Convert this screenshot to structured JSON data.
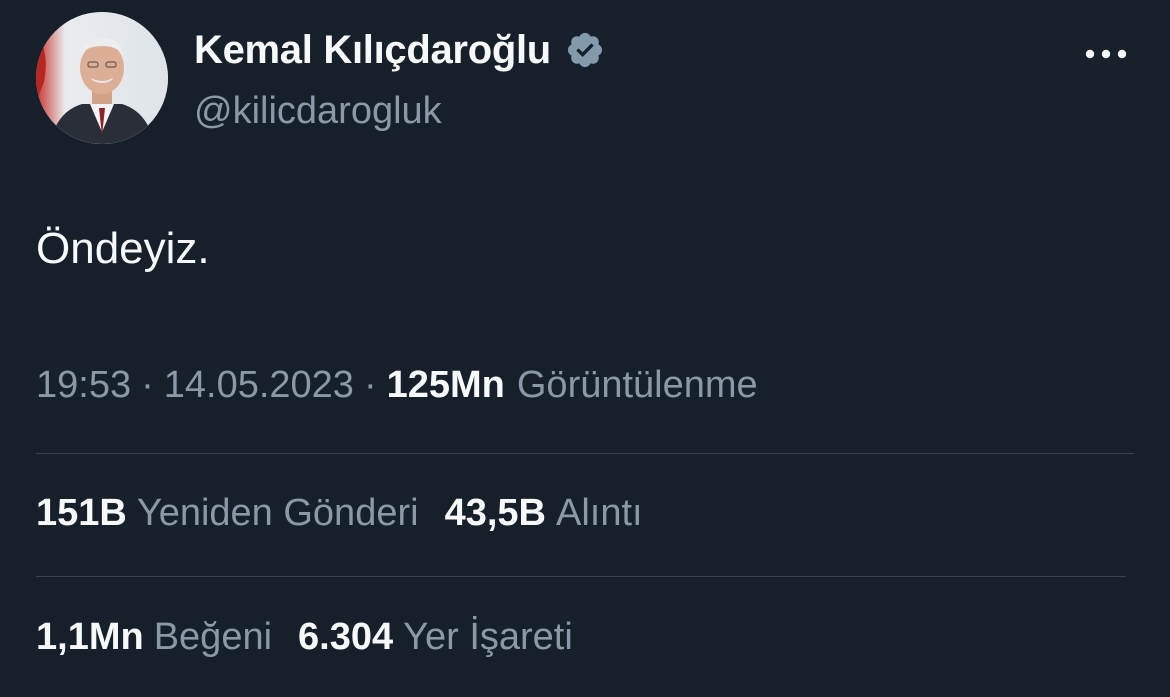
{
  "author": {
    "display_name": "Kemal Kılıçdaroğlu",
    "handle": "@kilicdarogluk",
    "verified_badge_icon": "verified-badge-icon"
  },
  "menu": {
    "more_icon": "more-options-icon"
  },
  "tweet": {
    "text": "Öndeyiz."
  },
  "meta": {
    "time": "19:53",
    "separator": "·",
    "date": "14.05.2023",
    "views_count": "125Mn",
    "views_label": "Görüntülenme"
  },
  "engagement": {
    "retweets_count": "151B",
    "retweets_label": "Yeniden Gönderi",
    "quotes_count": "43,5B",
    "quotes_label": "Alıntı",
    "likes_count": "1,1Mn",
    "likes_label": "Beğeni",
    "bookmarks_count": "6.304",
    "bookmarks_label": "Yer İşareti"
  },
  "colors": {
    "background": "#15202b",
    "primary_text": "#f7f9f9",
    "secondary_text": "#8b98a5",
    "divider": "#38444d",
    "verified_badge": "#829aab"
  }
}
